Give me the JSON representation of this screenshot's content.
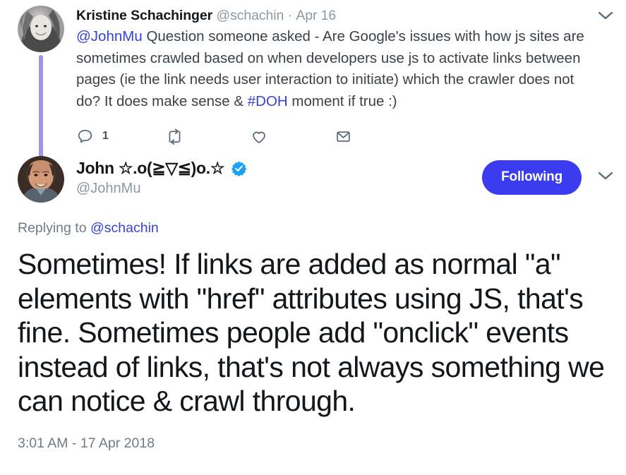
{
  "parent_tweet": {
    "author_name": "Kristine Schachinger",
    "author_handle": "@schachin",
    "separator": "·",
    "date": "Apr 16",
    "avatar_name": "kristine-schachinger-avatar",
    "text_parts": [
      {
        "type": "mention",
        "text": "@JohnMu"
      },
      {
        "type": "plain",
        "text": " Question someone asked - Are Google's issues with how js sites are sometimes crawled based on when developers use js to activate links between pages (ie the link needs user interaction to initiate) which the crawler does not do? It does make sense & "
      },
      {
        "type": "hashtag",
        "text": "#DOH"
      },
      {
        "type": "plain",
        "text": " moment if true :)"
      }
    ],
    "full_text": "@JohnMu Question someone asked - Are Google's issues with how js sites are sometimes crawled based on when developers use js to activate links between pages (ie the link needs user interaction to initiate) which the crawler does not do? It does make sense & #DOH moment if true :)",
    "actions": {
      "reply": {
        "icon": "reply-icon",
        "count": "1"
      },
      "retweet": {
        "icon": "retweet-icon",
        "count": ""
      },
      "like": {
        "icon": "heart-icon",
        "count": ""
      },
      "dm": {
        "icon": "envelope-icon",
        "count": ""
      }
    },
    "menu_icon": "chevron-down-icon"
  },
  "main_tweet": {
    "author_name": "John ☆.o(≧▽≦)o.☆",
    "author_handle": "@JohnMu",
    "verified_icon": "verified-badge-icon",
    "avatar_name": "johnmu-avatar",
    "follow_button_label": "Following",
    "menu_icon": "chevron-down-icon",
    "replying_to_prefix": "Replying to ",
    "replying_to_handle": "@schachin",
    "text": "Sometimes! If links are added as normal \"a\" elements with \"href\" attributes using JS, that's fine. Sometimes people add \"onclick\" events instead of links, that's not always something we can notice & crawl through.",
    "timestamp": "3:01 AM - 17 Apr 2018"
  },
  "colors": {
    "link": "#3442d6",
    "follow_button": "#3b3bf0",
    "verified_badge": "#1da1f2",
    "thread_line": "#9a9ae8",
    "muted_text": "#8d98a3",
    "action_icon": "#5b6b7c"
  }
}
